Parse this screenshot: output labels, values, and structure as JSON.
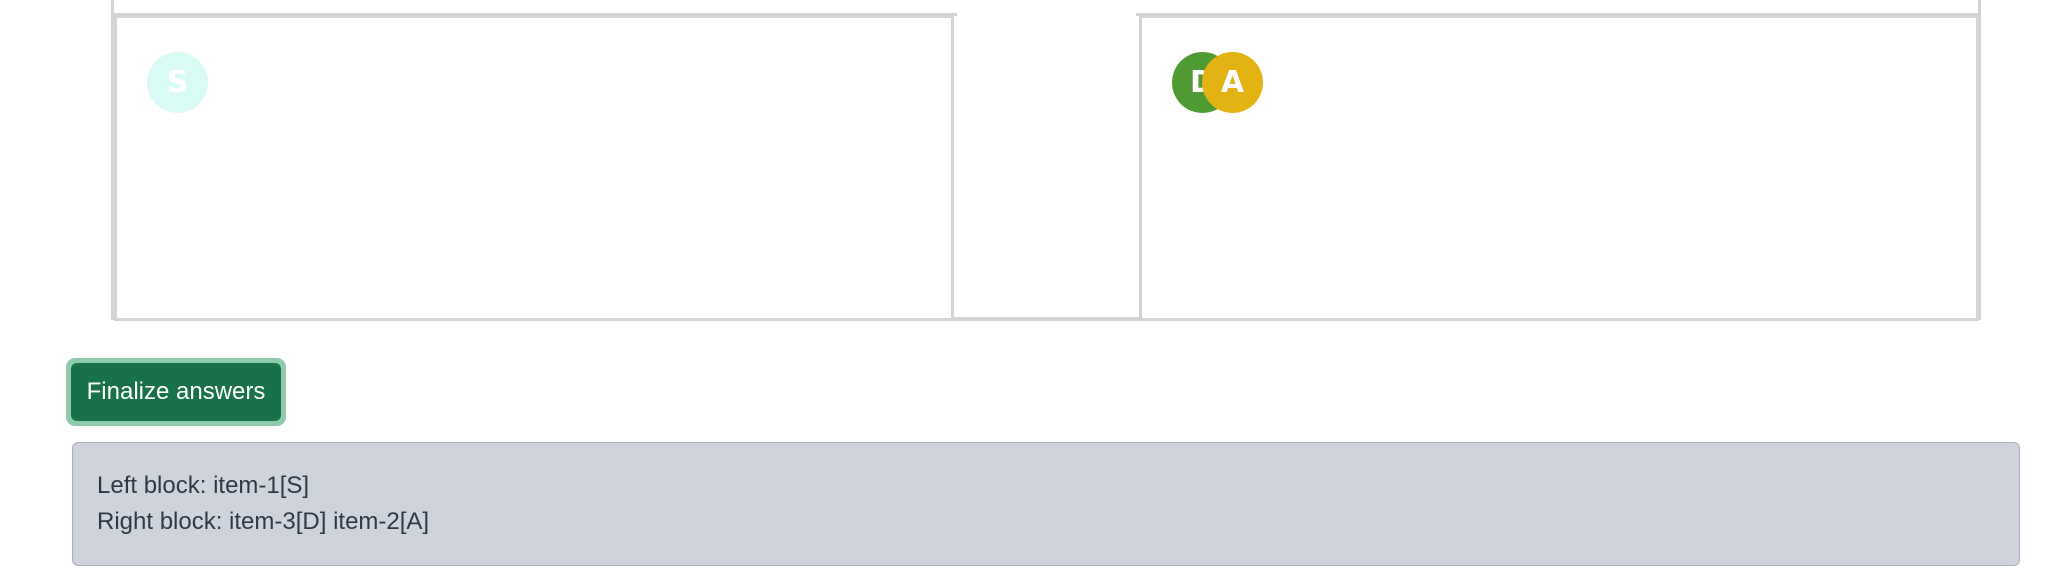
{
  "left_block": {
    "tokens": [
      {
        "letter": "S",
        "item": "item-1",
        "color": "#d8fbf5"
      }
    ]
  },
  "right_block": {
    "tokens": [
      {
        "letter": "D",
        "item": "item-3",
        "color": "#4f9a32"
      },
      {
        "letter": "A",
        "item": "item-2",
        "color": "#e2b312"
      }
    ]
  },
  "finalize_button": {
    "label": "Finalize answers",
    "color": "#187148",
    "ring_color": "#8fcaad"
  },
  "result": {
    "line1": "Left block: item-1[S]",
    "line2": "Right block: item-3[D] item-2[A]",
    "background": "#ced3dc"
  }
}
